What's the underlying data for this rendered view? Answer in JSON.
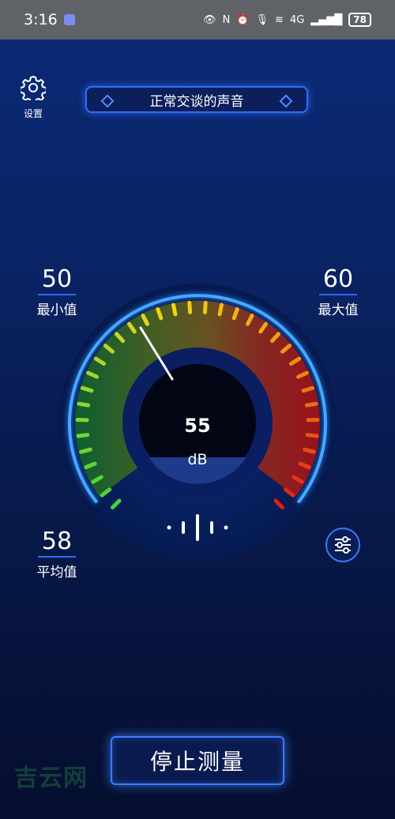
{
  "status_bar": {
    "time": "3:16",
    "battery": "78",
    "network": "4G"
  },
  "settings": {
    "label": "设置"
  },
  "mode": {
    "label": "正常交谈的声音"
  },
  "stats": {
    "min": {
      "value": "50",
      "label": "最小值"
    },
    "max": {
      "value": "60",
      "label": "最大值"
    },
    "avg": {
      "value": "58",
      "label": "平均值"
    }
  },
  "meter": {
    "value": "55",
    "unit": "dB"
  },
  "stop_button": {
    "label": "停止测量"
  },
  "watermark": {
    "text": "吉云网"
  },
  "colors": {
    "accent": "#2f6cff",
    "green": "#3fd33f",
    "yellow": "#f4d51b",
    "red": "#e21c1c"
  }
}
